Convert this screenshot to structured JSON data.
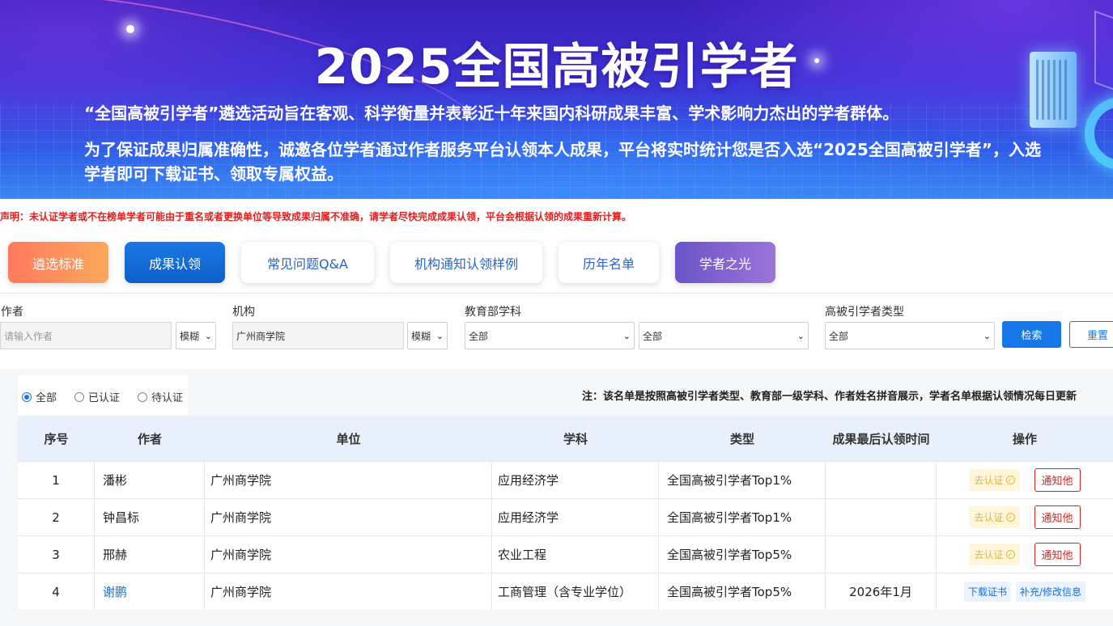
{
  "banner": {
    "title": "2025全国高被引学者",
    "intro_1": "“全国高被引学者”遴选活动旨在客观、科学衡量并表彰近十年来国内科研成果丰富、学术影响力杰出的学者群体。",
    "intro_2": "为了保证成果归属准确性，诚邀各位学者通过作者服务平台认领本人成果，平台将实时统计您是否入选“2025全国高被引学者”，入选学者即可下载证书、领取专属权益。"
  },
  "notice": "声明：未认证学者或不在榜单学者可能由于重名或者更换单位等导致成果归属不准确，请学者尽快完成成果认领，平台会根据认领的成果重新计算。",
  "tabs": [
    "遴选标准",
    "成果认领",
    "常见问题Q&A",
    "机构通知认领样例",
    "历年名单",
    "学者之光"
  ],
  "filters": {
    "author_label": "作者",
    "author_placeholder": "请输入作者",
    "author_match": "模糊",
    "org_label": "机构",
    "org_value": "广州商学院",
    "org_match": "模糊",
    "subject_label": "教育部学科",
    "subject_level1": "全部",
    "subject_level2": "全部",
    "type_label": "高被引学者类型",
    "type_value": "全部",
    "search_button": "检索",
    "reset_button": "重置"
  },
  "status_filter": {
    "options": [
      "全部",
      "已认证",
      "待认证"
    ],
    "selected": "全部"
  },
  "list_note": "注：该名单是按照高被引学者类型、教育部一级学科、作者姓名拼音展示，学者名单根据认领情况每日更新",
  "table": {
    "headers": [
      "序号",
      "作者",
      "单位",
      "学科",
      "类型",
      "成果最后认领时间",
      "操作"
    ],
    "rows": [
      {
        "no": "1",
        "author": "潘彬",
        "unit": "广州商学院",
        "subject": "应用经济学",
        "type": "全国高被引学者Top1%",
        "time": "",
        "action_1": "去认证",
        "action_2": "通知他",
        "certified": false
      },
      {
        "no": "2",
        "author": "钟昌标",
        "unit": "广州商学院",
        "subject": "应用经济学",
        "type": "全国高被引学者Top1%",
        "time": "",
        "action_1": "去认证",
        "action_2": "通知他",
        "certified": false
      },
      {
        "no": "3",
        "author": "邢赫",
        "unit": "广州商学院",
        "subject": "农业工程",
        "type": "全国高被引学者Top5%",
        "time": "",
        "action_1": "去认证",
        "action_2": "通知他",
        "certified": false
      },
      {
        "no": "4",
        "author": "谢鹏",
        "unit": "广州商学院",
        "subject": "工商管理（含专业学位）",
        "type": "全国高被引学者Top5%",
        "time": "2026年1月",
        "action_1": "下载证书",
        "action_2": "补充/修改信息",
        "certified": true
      }
    ]
  },
  "colors": {
    "accent_blue": "#1677e8",
    "notice_red": "#e0201e",
    "pending_gold": "#e0b43a"
  }
}
